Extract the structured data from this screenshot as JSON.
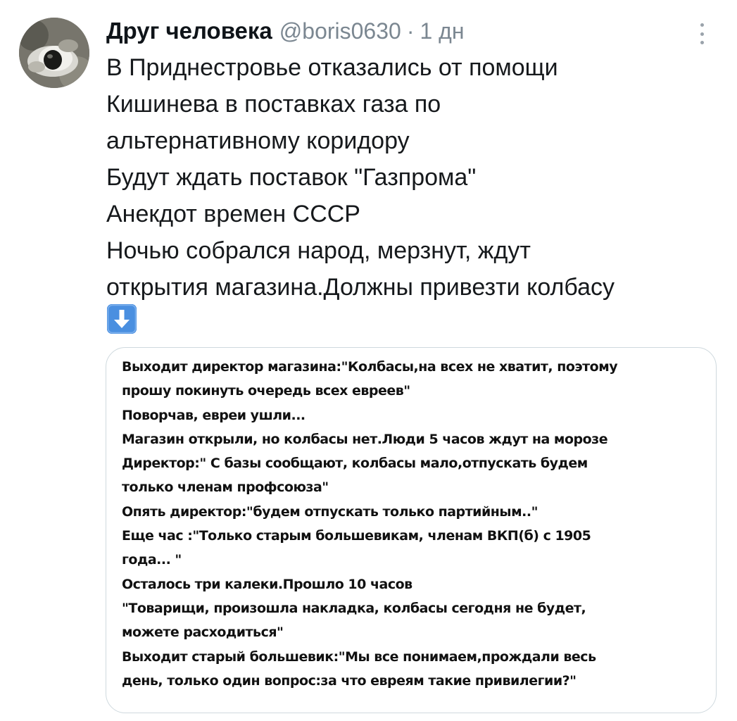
{
  "tweet": {
    "author": {
      "display_name": "Друг человека",
      "handle": "@boris0630",
      "separator": "·",
      "timestamp": "1 дн"
    },
    "more_menu_icon": "more-vertical-icon",
    "text_lines": [
      "В Приднестровье отказались от помощи",
      "Кишинева в поставках газа по",
      "альтернативному коридору",
      "Будут ждать поставок  \"Газпрома\"",
      "Анекдот времен СССР",
      "Ночью собрался народ, мерзнут, ждут",
      "открытия магазина.Должны привезти колбасу"
    ],
    "emoji": "down-arrow-emoji",
    "media": {
      "text_lines": [
        "Выходит директор магазина:\"Колбасы,на всех не хватит, поэтому",
        "прошу покинуть очередь всех евреев\"",
        "Поворчав, евреи ушли...",
        "Магазин открыли, но колбасы нет.Люди 5 часов ждут на морозе",
        "Директор:\" С базы сообщают, колбасы мало,отпускать будем",
        "только членам профсоюза\"",
        "Опять директор:\"будем отпускать только партийным..\"",
        "Еще час :\"Только старым большевикам, членам ВКП(б) с 1905",
        "года... \"",
        "Осталось три калеки.Прошло 10 часов",
        "\"Товарищи, произошла накладка, колбасы сегодня не будет,",
        "можете расходиться\"",
        "Выходит старый большевик:\"Мы все понимаем,прождали весь",
        "день, только один вопрос:за что евреям такие привилегии?\""
      ]
    }
  },
  "colors": {
    "name": "#0f1419",
    "secondary_text": "#7b8791",
    "body_text": "#16191c",
    "card_border": "#cfd9de",
    "emoji_blue": "#4a8fe0"
  }
}
